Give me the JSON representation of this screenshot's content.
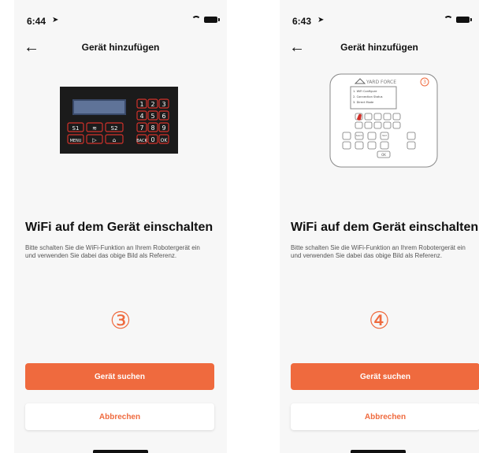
{
  "screens": [
    {
      "time": "6:44",
      "title": "Gerät hinzufügen",
      "heading": "WiFi auf dem Gerät einschalten",
      "description": "Bitte schalten Sie die WiFi-Funktion an Ihrem Robotergerät ein und verwenden Sie dabei das obige Bild als Referenz.",
      "step": "③",
      "primary_button": "Gerät suchen",
      "secondary_button": "Abbrechen",
      "keypad_keys": [
        "S1",
        "S2",
        "MENU",
        "BACK",
        "OK",
        "1",
        "2",
        "3",
        "4",
        "5",
        "6",
        "7",
        "8",
        "9",
        "0"
      ]
    },
    {
      "time": "6:43",
      "title": "Gerät hinzufügen",
      "heading": "WiFi auf dem Gerät einschalten",
      "description": "Bitte schalten Sie die WiFi-Funktion an Ihrem Robotergerät ein und verwenden Sie dabei das obige Bild als Referenz.",
      "step": "④",
      "primary_button": "Gerät suchen",
      "secondary_button": "Abbrechen",
      "brand": "YARD FORCE",
      "marker": "3",
      "menu_items": [
        "1. WiFi Configure",
        "2. Connection Status",
        "3. Direct Mode"
      ],
      "key_labels": [
        "Search",
        "Start",
        "OK"
      ]
    }
  ],
  "colors": {
    "accent": "#ef6a3e",
    "background": "#f7f7f7",
    "keypad_red": "#d2322b"
  }
}
